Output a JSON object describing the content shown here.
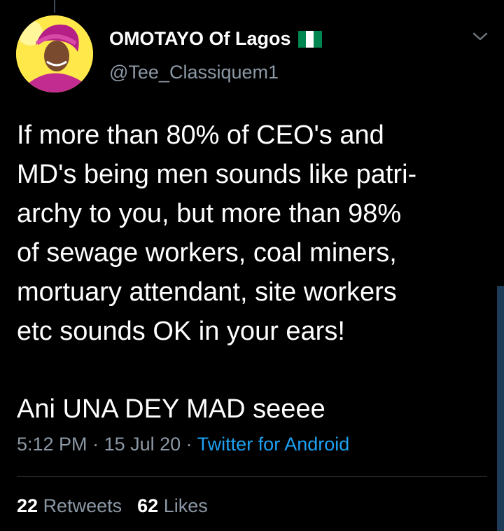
{
  "tweet": {
    "display_name": "OMOTAYO Of Lagos",
    "handle": "@Tee_Classiquem1",
    "body": "If more than 80% of CEO's and\nMD's being men sounds like patri-\narchy to you, but more than 98%\nof sewage workers, coal miners,\nmortuary attendant, site workers\netc sounds OK in your ears!",
    "body_second": "Ani UNA DEY MAD seeee",
    "time": "5:12 PM",
    "date": "15 Jul 20",
    "separator": " · ",
    "source": "Twitter for Android",
    "retweets_count": "22",
    "retweets_label": "Retweets",
    "likes_count": "62",
    "likes_label": "Likes"
  },
  "icons": {
    "flag": "nigeria-flag-icon",
    "menu": "chevron-down-icon"
  },
  "colors": {
    "background": "#000000",
    "text": "#ffffff",
    "muted": "#8b98a5",
    "link": "#1da1f2",
    "flag_green": "#008751"
  }
}
